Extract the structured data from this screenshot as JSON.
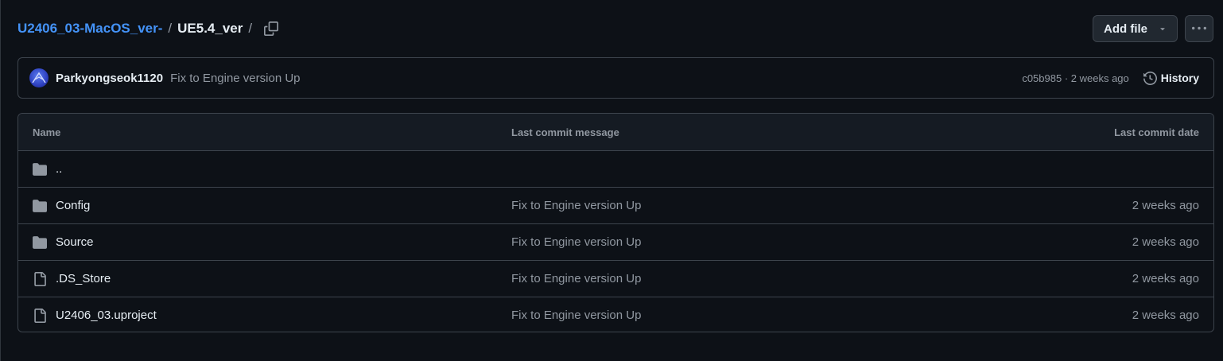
{
  "breadcrumb": {
    "repo": "U2406_03-MacOS_ver-",
    "separator": "/",
    "current": "UE5.4_ver",
    "trailing_separator": "/"
  },
  "header_actions": {
    "add_file_label": "Add file",
    "more_label": "···"
  },
  "commit": {
    "author": "Parkyongseok1120",
    "message": "Fix to Engine version Up",
    "hash_and_age": "c05b985 · 2 weeks ago",
    "history_label": "History"
  },
  "table": {
    "headers": {
      "name": "Name",
      "message": "Last commit message",
      "date": "Last commit date"
    },
    "rows": [
      {
        "type": "folder",
        "name": "..",
        "message": "",
        "date": ""
      },
      {
        "type": "folder",
        "name": "Config",
        "message": "Fix to Engine version Up",
        "date": "2 weeks ago"
      },
      {
        "type": "folder",
        "name": "Source",
        "message": "Fix to Engine version Up",
        "date": "2 weeks ago"
      },
      {
        "type": "file",
        "name": ".DS_Store",
        "message": "Fix to Engine version Up",
        "date": "2 weeks ago"
      },
      {
        "type": "file",
        "name": "U2406_03.uproject",
        "message": "Fix to Engine version Up",
        "date": "2 weeks ago"
      }
    ]
  },
  "colors": {
    "background": "#0d1117",
    "link": "#4493f8",
    "border": "#3d444d",
    "muted_text": "#9198a1",
    "header_bg": "#151b23"
  },
  "icons": {
    "copy": "copy-icon",
    "caret": "triangle-down-icon",
    "kebab": "kebab-horizontal-icon",
    "history": "history-clock-icon",
    "folder": "folder-icon",
    "file": "file-icon"
  }
}
